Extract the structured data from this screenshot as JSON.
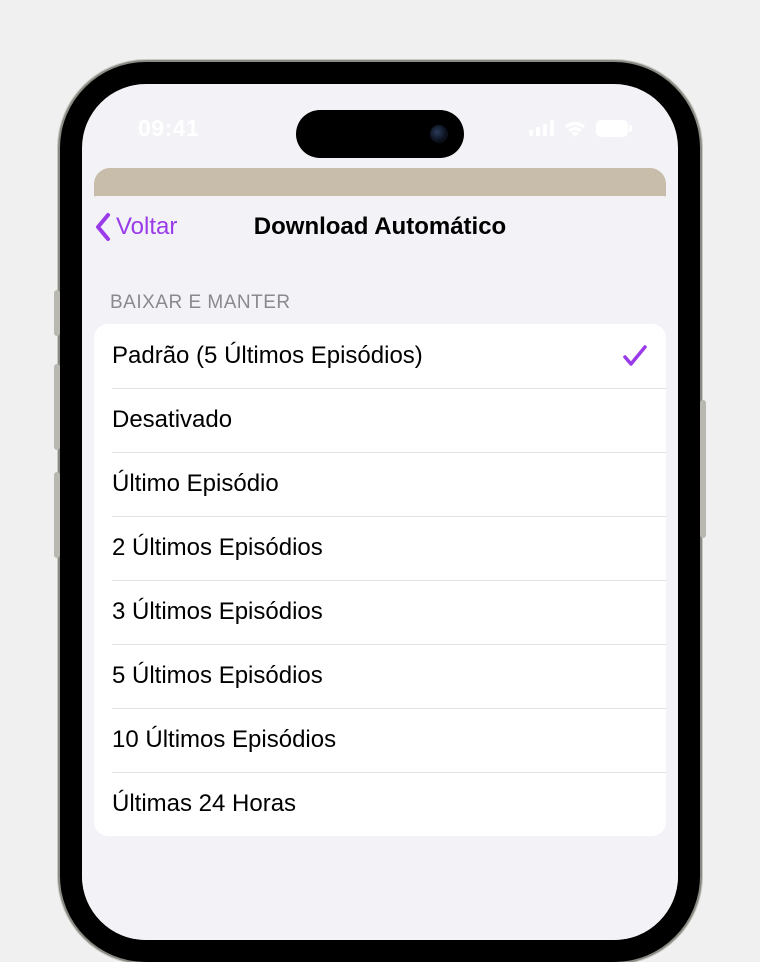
{
  "status": {
    "time": "09:41"
  },
  "nav": {
    "back_label": "Voltar",
    "title": "Download Automático"
  },
  "section": {
    "header": "BAIXAR E MANTER"
  },
  "options": [
    {
      "label": "Padrão (5 Últimos Episódios)",
      "selected": true
    },
    {
      "label": "Desativado",
      "selected": false
    },
    {
      "label": "Último Episódio",
      "selected": false
    },
    {
      "label": "2 Últimos Episódios",
      "selected": false
    },
    {
      "label": "3 Últimos Episódios",
      "selected": false
    },
    {
      "label": "5 Últimos Episódios",
      "selected": false
    },
    {
      "label": "10 Últimos Episódios",
      "selected": false
    },
    {
      "label": "Últimas 24 Horas",
      "selected": false
    }
  ],
  "colors": {
    "accent": "#9a3bea",
    "sheet_bg": "#f2f2f7",
    "row_bg": "#ffffff"
  }
}
